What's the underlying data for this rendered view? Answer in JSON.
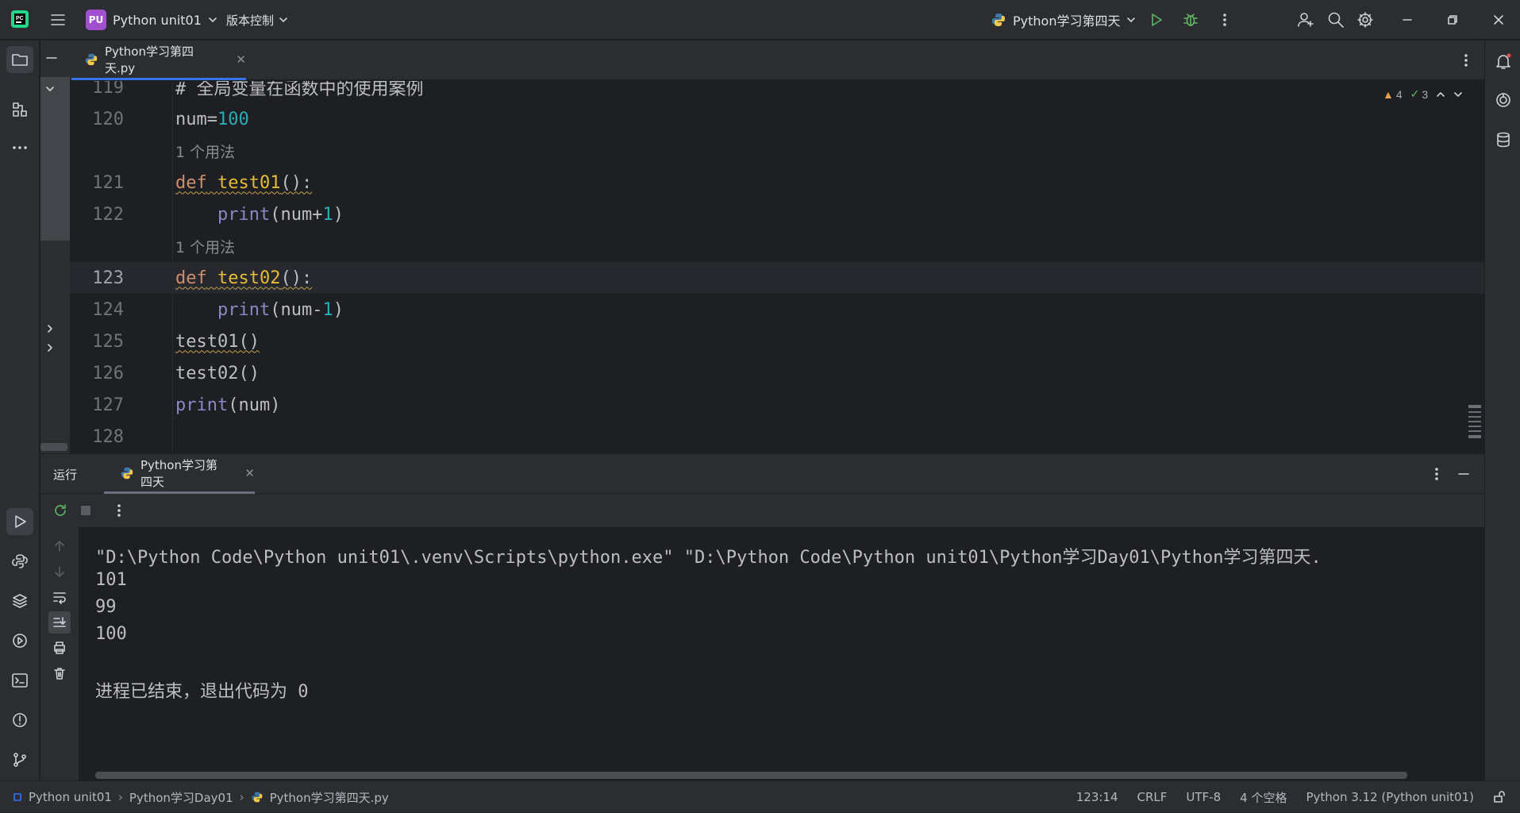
{
  "titlebar": {
    "project_badge": "PU",
    "project_name": "Python unit01",
    "vcs_label": "版本控制",
    "run_config": "Python学习第四天"
  },
  "editor": {
    "tab_label": "Python学习第四天.py",
    "lines": [
      {
        "n": "119",
        "text": "# 全局变量在函数中的使用案例"
      },
      {
        "n": "120",
        "text": "num=100"
      },
      {
        "hint": "1 个用法"
      },
      {
        "n": "121",
        "text": "def test01():"
      },
      {
        "n": "122",
        "text": "    print(num+1)"
      },
      {
        "hint": "1 个用法"
      },
      {
        "n": "123",
        "text": "def test02():"
      },
      {
        "n": "124",
        "text": "    print(num-1)"
      },
      {
        "n": "125",
        "text": "test01()"
      },
      {
        "n": "126",
        "text": "test02()"
      },
      {
        "n": "127",
        "text": "print(num)"
      },
      {
        "n": "128",
        "text": ""
      }
    ],
    "warnings": "4",
    "checks": "3"
  },
  "run": {
    "title": "运行",
    "tab_label": "Python学习第四天",
    "output": [
      "\"D:\\Python Code\\Python unit01\\.venv\\Scripts\\python.exe\" \"D:\\Python Code\\Python unit01\\Python学习Day01\\Python学习第四天.",
      "101",
      "99",
      "100",
      "",
      "进程已结束，退出代码为 0"
    ]
  },
  "statusbar": {
    "crumbs": [
      "Python unit01",
      "Python学习Day01",
      "Python学习第四天.py"
    ],
    "position": "123:14",
    "line_sep": "CRLF",
    "encoding": "UTF-8",
    "indent": "4 个空格",
    "interpreter": "Python 3.12 (Python unit01)"
  },
  "colors": {
    "accent": "#3574f0",
    "run_green": "#5fb865",
    "badge_purple": "#a24fd0"
  }
}
